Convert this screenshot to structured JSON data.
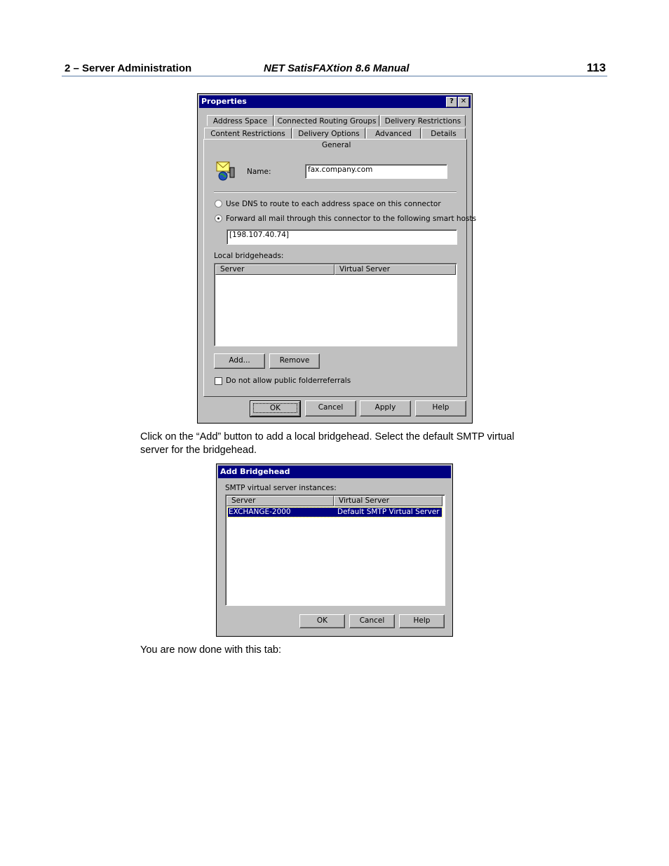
{
  "header": {
    "section": "2  – Server Administration",
    "manual": "NET SatisFAXtion 8.6 Manual",
    "page_number": "113"
  },
  "properties_dialog": {
    "title": "Properties",
    "help_glyph": "?",
    "close_glyph": "✕",
    "tabs_row1": [
      "Address Space",
      "Connected Routing Groups",
      "Delivery Restrictions"
    ],
    "tabs_row2": [
      "Content Restrictions",
      "Delivery Options",
      "Advanced",
      "Details"
    ],
    "active_tab": "General",
    "name_label": "Name:",
    "name_value": "fax.company.com",
    "radio_dns": "Use DNS to route to each address space on this connector",
    "radio_forward": "Forward all mail through this connector to the following smart hosts",
    "smart_host": "[198.107.40.74]",
    "bridgeheads_label": "Local bridgeheads:",
    "columns": [
      "Server",
      "Virtual Server"
    ],
    "add_button": "Add...",
    "remove_button": "Remove",
    "checkbox_label": "Do not allow public folderreferrals",
    "ok": "OK",
    "cancel": "Cancel",
    "apply": "Apply",
    "help": "Help"
  },
  "para1": "Click on the “Add” button to add a local bridgehead. Select the default SMTP virtual server for the bridgehead.",
  "add_bridgehead": {
    "title": "Add Bridgehead",
    "instances_label": "SMTP virtual server instances:",
    "columns": [
      "Server",
      "Virtual Server"
    ],
    "row": {
      "server": "EXCHANGE-2000",
      "virtual_server": "Default SMTP Virtual Server"
    },
    "ok": "OK",
    "cancel": "Cancel",
    "help": "Help"
  },
  "para2": "You are now done with this tab:",
  "colors": {
    "titlebar": "#000080",
    "dialog_face": "#c0c0c0",
    "header_rule": "#5a7da6"
  },
  "icons": {
    "connector": "mail-globe-icon"
  }
}
